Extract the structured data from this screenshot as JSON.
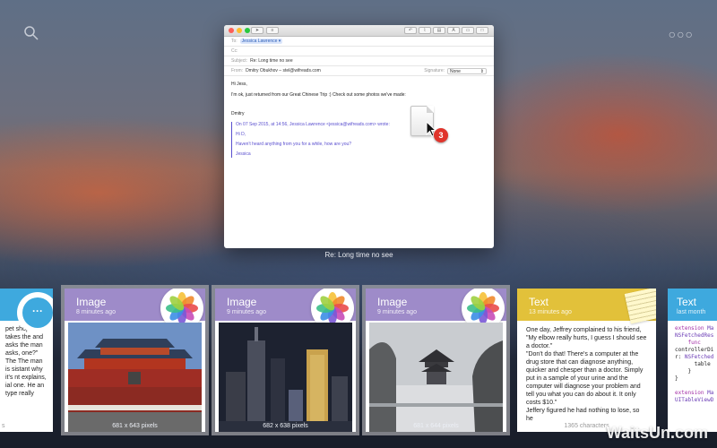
{
  "topbar": {
    "search_icon": "search-icon",
    "more_label": "○○○"
  },
  "mail": {
    "to_label": "To:",
    "to_value": "Jessica Lawrence ▾",
    "cc_label": "Cc:",
    "subject_label": "Subject:",
    "subject_value": "Re: Long time no see",
    "from_label": "From:",
    "from_value": "Dmitry Obukhov – stel@wifreads.com",
    "signature_label": "Signature:",
    "signature_value": "None",
    "greeting": "Hi Jess,",
    "line1": "I'm ok, just returned from our Great Chinese Trip :) Check out some photos we've made:",
    "sign": "Dmitry",
    "quote_header": "On 07 Sep 2015, at 14:56, Jessica Lawrence <jessica@wifreads.com> wrote:",
    "quote_hi": "Hi D,",
    "quote_body": "Haven't heard anything from you for a while, how are you?",
    "quote_sign": "Jessica",
    "drag_badge": "3",
    "caption": "Re: Long time no see"
  },
  "cards": {
    "left_partial": {
      "text": "pet shop to nt takes the and asks the man asks, one?\" The The man is sistant why it's nt explains, ial one. He an type really",
      "footer": "s"
    },
    "card1": {
      "type": "Image",
      "time": "8 minutes ago",
      "dims": "681 x 643 pixels"
    },
    "card2": {
      "type": "Image",
      "time": "9 minutes ago",
      "dims": "682 x 638 pixels"
    },
    "card3": {
      "type": "Image",
      "time": "9 minutes ago",
      "dims": "681 x 644 pixels"
    },
    "text_card": {
      "type": "Text",
      "time": "13 minutes ago",
      "body1": "One day, Jeffrey complained to his friend, \"My elbow really hurts, I guess I should see a doctor.\"",
      "body2": "\"Don't do that! There's a computer at the drug store that can diagnose anything, quicker and chesper than a doctor. Simply put in a sample of your urine and the computer will diagnose your problem and tell you what you can do about it. It only costs $10.\"",
      "body3": "Jeffery figured he had nothing to lose, so he",
      "footer": "1365 characters"
    },
    "code_card": {
      "type": "Text",
      "time": "last month"
    }
  },
  "watermark": "WaitsUn.com",
  "colors": {
    "image_header": "#9e8bc9",
    "text_header": "#e2c13a",
    "code_header": "#3ea9de",
    "badge": "#e0342c"
  }
}
